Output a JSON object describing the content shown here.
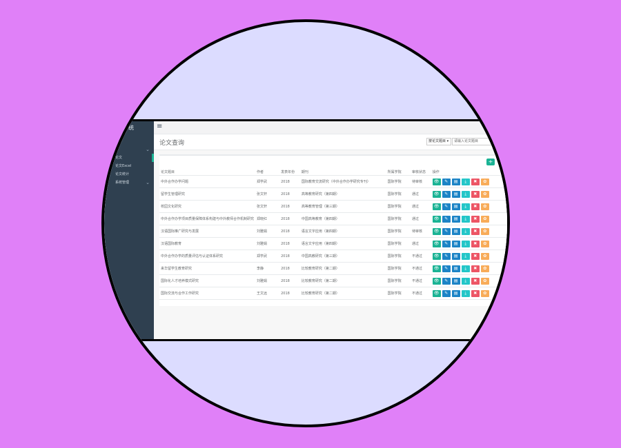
{
  "sidebar": {
    "brand": "系统",
    "menu": [
      {
        "label": "",
        "chevron": "⌄"
      },
      {
        "label": "论文",
        "chevron": ""
      },
      {
        "label": "论文Excel",
        "chevron": ""
      },
      {
        "label": "论文统计",
        "chevron": ""
      },
      {
        "label": "系统管理",
        "chevron": "⌄"
      }
    ]
  },
  "topbar": {
    "menu_icon": "≡"
  },
  "pagehead": {
    "title": "论文查询",
    "select_value": "按论文题目 ▾",
    "search_placeholder": "请输入论文题目",
    "go_icon": "›"
  },
  "table": {
    "add_label": "+",
    "headers": [
      "论文题目",
      "作者",
      "发表年份",
      "期刊",
      "所属学院",
      "审核状态",
      "操作"
    ],
    "rows": [
      [
        "中外合作办学问题",
        "郑学武",
        "2018",
        "国际教育交流研究（中外合作办学研究专刊）",
        "国际学院",
        "待审核"
      ],
      [
        "留学生管理研究",
        "张文轩",
        "2018",
        "高等教育研究（第四期）",
        "国际学院",
        "通过"
      ],
      [
        "校园文化研究",
        "张文轩",
        "2018",
        "高等教育管理（第三期）",
        "国际学院",
        "通过"
      ],
      [
        "中外合作办学项目质量保障体系构建与中外教师合作机制研究",
        "郑晓红",
        "2018",
        "中国高等教育（第四期）",
        "国际学院",
        "通过"
      ],
      [
        "汉语国际推广研究与发展",
        "刘雅娟",
        "2018",
        "语言文字应用（第四期）",
        "国际学院",
        "待审核"
      ],
      [
        "汉语国际教育",
        "刘雅娟",
        "2018",
        "语言文字应用（第四期）",
        "国际学院",
        "通过"
      ],
      [
        "中外合作办学的质量评估与认证体系研究",
        "郑学武",
        "2018",
        "中国高教研究（第三期）",
        "国际学院",
        "不通过"
      ],
      [
        "来华留学生教育研究",
        "李静",
        "2018",
        "比较教育研究（第二期）",
        "国际学院",
        "不通过"
      ],
      [
        "国际化人才培养模式研究",
        "刘雅娟",
        "2018",
        "比较教育研究（第二期）",
        "国际学院",
        "不通过"
      ],
      [
        "国际交流与合作工作研究",
        "王文远",
        "2018",
        "比较教育研究（第二期）",
        "国际学院",
        "不通过"
      ]
    ],
    "action_icons": [
      {
        "name": "view-icon",
        "glyph": "👁"
      },
      {
        "name": "edit-icon",
        "glyph": "✎"
      },
      {
        "name": "file-icon",
        "glyph": "▤"
      },
      {
        "name": "download-icon",
        "glyph": "⤓"
      },
      {
        "name": "delete-icon",
        "glyph": "✖"
      },
      {
        "name": "audit-icon",
        "glyph": "✿"
      }
    ]
  },
  "colors": {
    "sidebar": "#2f4050",
    "accent": "#1ab394",
    "primary": "#1c84c6",
    "info": "#23c6c8",
    "danger": "#ed5565",
    "warning": "#f8ac59",
    "background": "#e080f8",
    "circle": "#dcdcff"
  }
}
